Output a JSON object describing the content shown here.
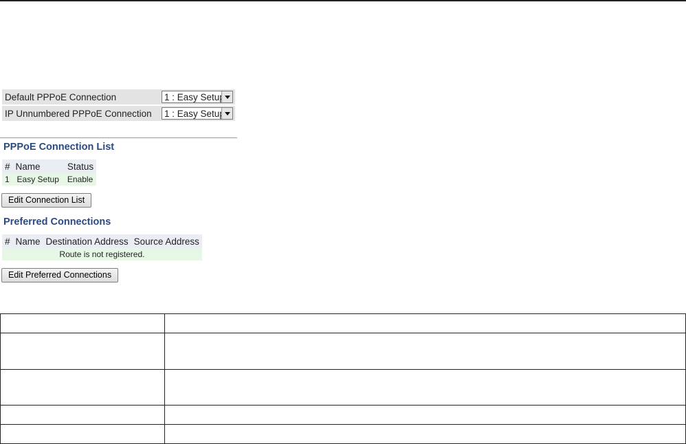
{
  "settings": {
    "default_label": "Default PPPoE Connection",
    "default_value": "1 : Easy Setup",
    "unnumbered_label": "IP Unnumbered PPPoE Connection",
    "unnumbered_value": "1 : Easy Setup"
  },
  "connection_list": {
    "title": "PPPoE Connection List",
    "headers": [
      "#",
      "Name",
      "Status"
    ],
    "rows": [
      [
        "1",
        "Easy Setup",
        "Enable"
      ]
    ],
    "button": "Edit Connection List"
  },
  "preferred": {
    "title": "Preferred Connections",
    "headers": [
      "#",
      "Name",
      "Destination Address",
      "Source Address"
    ],
    "empty_message": "Route is not registered.",
    "button": "Edit Preferred Connections"
  },
  "description_table": {
    "rows": [
      [
        "",
        ""
      ],
      [
        "",
        ""
      ],
      [
        "",
        ""
      ],
      [
        "",
        ""
      ],
      [
        "",
        ""
      ]
    ]
  }
}
